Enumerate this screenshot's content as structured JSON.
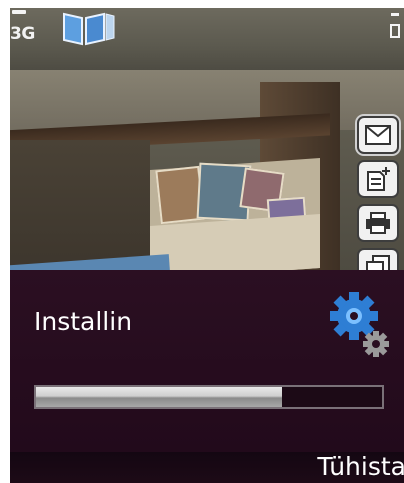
{
  "status_bar": {
    "network": "3G",
    "icons": [
      "signal-icon",
      "app-icon",
      "battery-icon"
    ]
  },
  "toolbar": {
    "items": [
      {
        "name": "mail-icon",
        "selected": true
      },
      {
        "name": "document-add-icon",
        "selected": false
      },
      {
        "name": "print-icon",
        "selected": false
      },
      {
        "name": "copy-icon",
        "selected": false
      }
    ]
  },
  "dialog": {
    "message": "Installin",
    "icon": "gear-icon",
    "progress": 0.71
  },
  "softkeys": {
    "right_label": "Tühista"
  }
}
